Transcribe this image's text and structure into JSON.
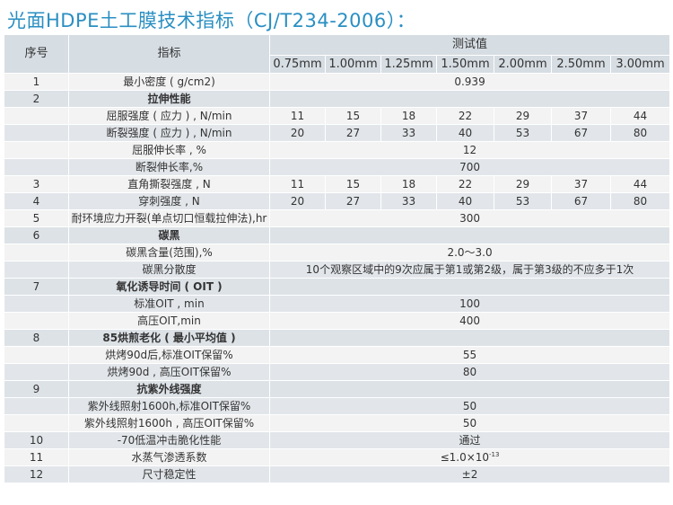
{
  "title": "光面HDPE土工膜技术指标（CJ/T234-2006）：",
  "table": {
    "headers": {
      "no": "序号",
      "item": "指标",
      "test": "测试值",
      "thickness": [
        "0.75mm",
        "1.00mm",
        "1.25mm",
        "1.50mm",
        "2.00mm",
        "2.50mm",
        "3.00mm"
      ]
    },
    "rows": [
      {
        "no": "1",
        "item": "最小密度 ( g/cm2)",
        "span": "0.939"
      },
      {
        "no": "2",
        "item": "拉伸性能",
        "section": true
      },
      {
        "no": "",
        "item": "屈服强度 ( 应力 ) , N/min",
        "values": [
          "11",
          "15",
          "18",
          "22",
          "29",
          "37",
          "44"
        ]
      },
      {
        "no": "",
        "item": "断裂强度 ( 应力 ) , N/min",
        "values": [
          "20",
          "27",
          "33",
          "40",
          "53",
          "67",
          "80"
        ]
      },
      {
        "no": "",
        "item": "屈服伸长率 , %",
        "span": "12"
      },
      {
        "no": "",
        "item": "断裂伸长率,%",
        "span": "700"
      },
      {
        "no": "3",
        "item": "直角撕裂强度 , N",
        "values": [
          "11",
          "15",
          "18",
          "22",
          "29",
          "37",
          "44"
        ]
      },
      {
        "no": "4",
        "item": "穿刺强度 , N",
        "values": [
          "20",
          "27",
          "33",
          "40",
          "53",
          "67",
          "80"
        ]
      },
      {
        "no": "5",
        "item": "耐环境应力开裂(单点切口恒载拉伸法),hr",
        "span": "300"
      },
      {
        "no": "6",
        "item": "碳黑",
        "section": true
      },
      {
        "no": "",
        "item": "碳黑含量(范围),%",
        "span": "2.0～3.0"
      },
      {
        "no": "",
        "item": "碳黑分散度",
        "span": "10个观察区域中的9次应属于第1或第2级，属于第3级的不应多于1次"
      },
      {
        "no": "7",
        "item": "氧化诱导时间 ( OIT )",
        "section": true
      },
      {
        "no": "",
        "item": "标准OIT , min",
        "span": "100"
      },
      {
        "no": "",
        "item": "高压OIT,min",
        "span": "400"
      },
      {
        "no": "8",
        "item": "85烘煎老化 ( 最小平均值 )",
        "section": true
      },
      {
        "no": "",
        "item": "烘烤90d后,标准OIT保留%",
        "span": "55"
      },
      {
        "no": "",
        "item": "烘烤90d , 高压OIT保留%",
        "span": "80"
      },
      {
        "no": "9",
        "item": "抗紫外线强度",
        "section": true
      },
      {
        "no": "",
        "item": "紫外线照射1600h,标准OIT保留%",
        "span": "50"
      },
      {
        "no": "",
        "item": "紫外线照射1600h , 高压OIT保留%",
        "span": "50"
      },
      {
        "no": "10",
        "item": "-70低温冲击脆化性能",
        "span": "通过"
      },
      {
        "no": "11",
        "item": "水蒸气渗透系数",
        "span_prefix": "≤1.0×10",
        "span_exp": "-13"
      },
      {
        "no": "12",
        "item": "尺寸稳定性",
        "span": "±2"
      }
    ]
  }
}
